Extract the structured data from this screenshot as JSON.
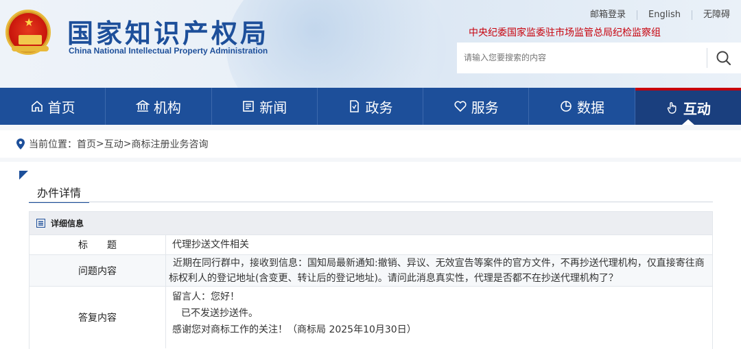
{
  "header": {
    "logo_cn": "国家知识产权局",
    "logo_en": "China National Intellectual Property Administration",
    "links": [
      "邮箱登录",
      "English",
      "无障碍"
    ],
    "notice": "中央纪委国家监委驻市场监管总局纪检监察组",
    "search_placeholder": "请输入您要搜索的内容"
  },
  "nav": [
    {
      "label": "首页",
      "icon": "home-icon"
    },
    {
      "label": "机构",
      "icon": "institution-icon"
    },
    {
      "label": "新闻",
      "icon": "news-icon"
    },
    {
      "label": "政务",
      "icon": "government-affairs-icon"
    },
    {
      "label": "服务",
      "icon": "service-icon"
    },
    {
      "label": "数据",
      "icon": "data-chart-icon"
    },
    {
      "label": "互动",
      "icon": "interaction-hand-icon",
      "active": true
    }
  ],
  "breadcrumb": {
    "prefix": "当前位置：",
    "items": [
      "首页",
      "互动",
      "商标注册业务咨询"
    ],
    "separator": ">"
  },
  "content": {
    "tab_title": "办件详情",
    "section_title": "详细信息",
    "rows": [
      {
        "key": "标　　题",
        "value": "代理抄送文件相关"
      },
      {
        "key": "问题内容",
        "value": "近期在同行群中，接收到信息：国知局最新通知:撤销、异议、无效宣告等案件的官方文件，不再抄送代理机构，仅直接寄往商标权利人的登记地址(含变更、转让后的登记地址)。请问此消息真实性，代理是否都不在抄送代理机构了？"
      },
      {
        "key": "答复内容",
        "lines": [
          "留言人：您好！",
          "已不发送抄送件。",
          "感谢您对商标工作的关注！（商标局 2025年10月30日）"
        ]
      }
    ]
  },
  "colors": {
    "brand_blue": "#1d4f9a",
    "accent_red": "#c7000b"
  }
}
